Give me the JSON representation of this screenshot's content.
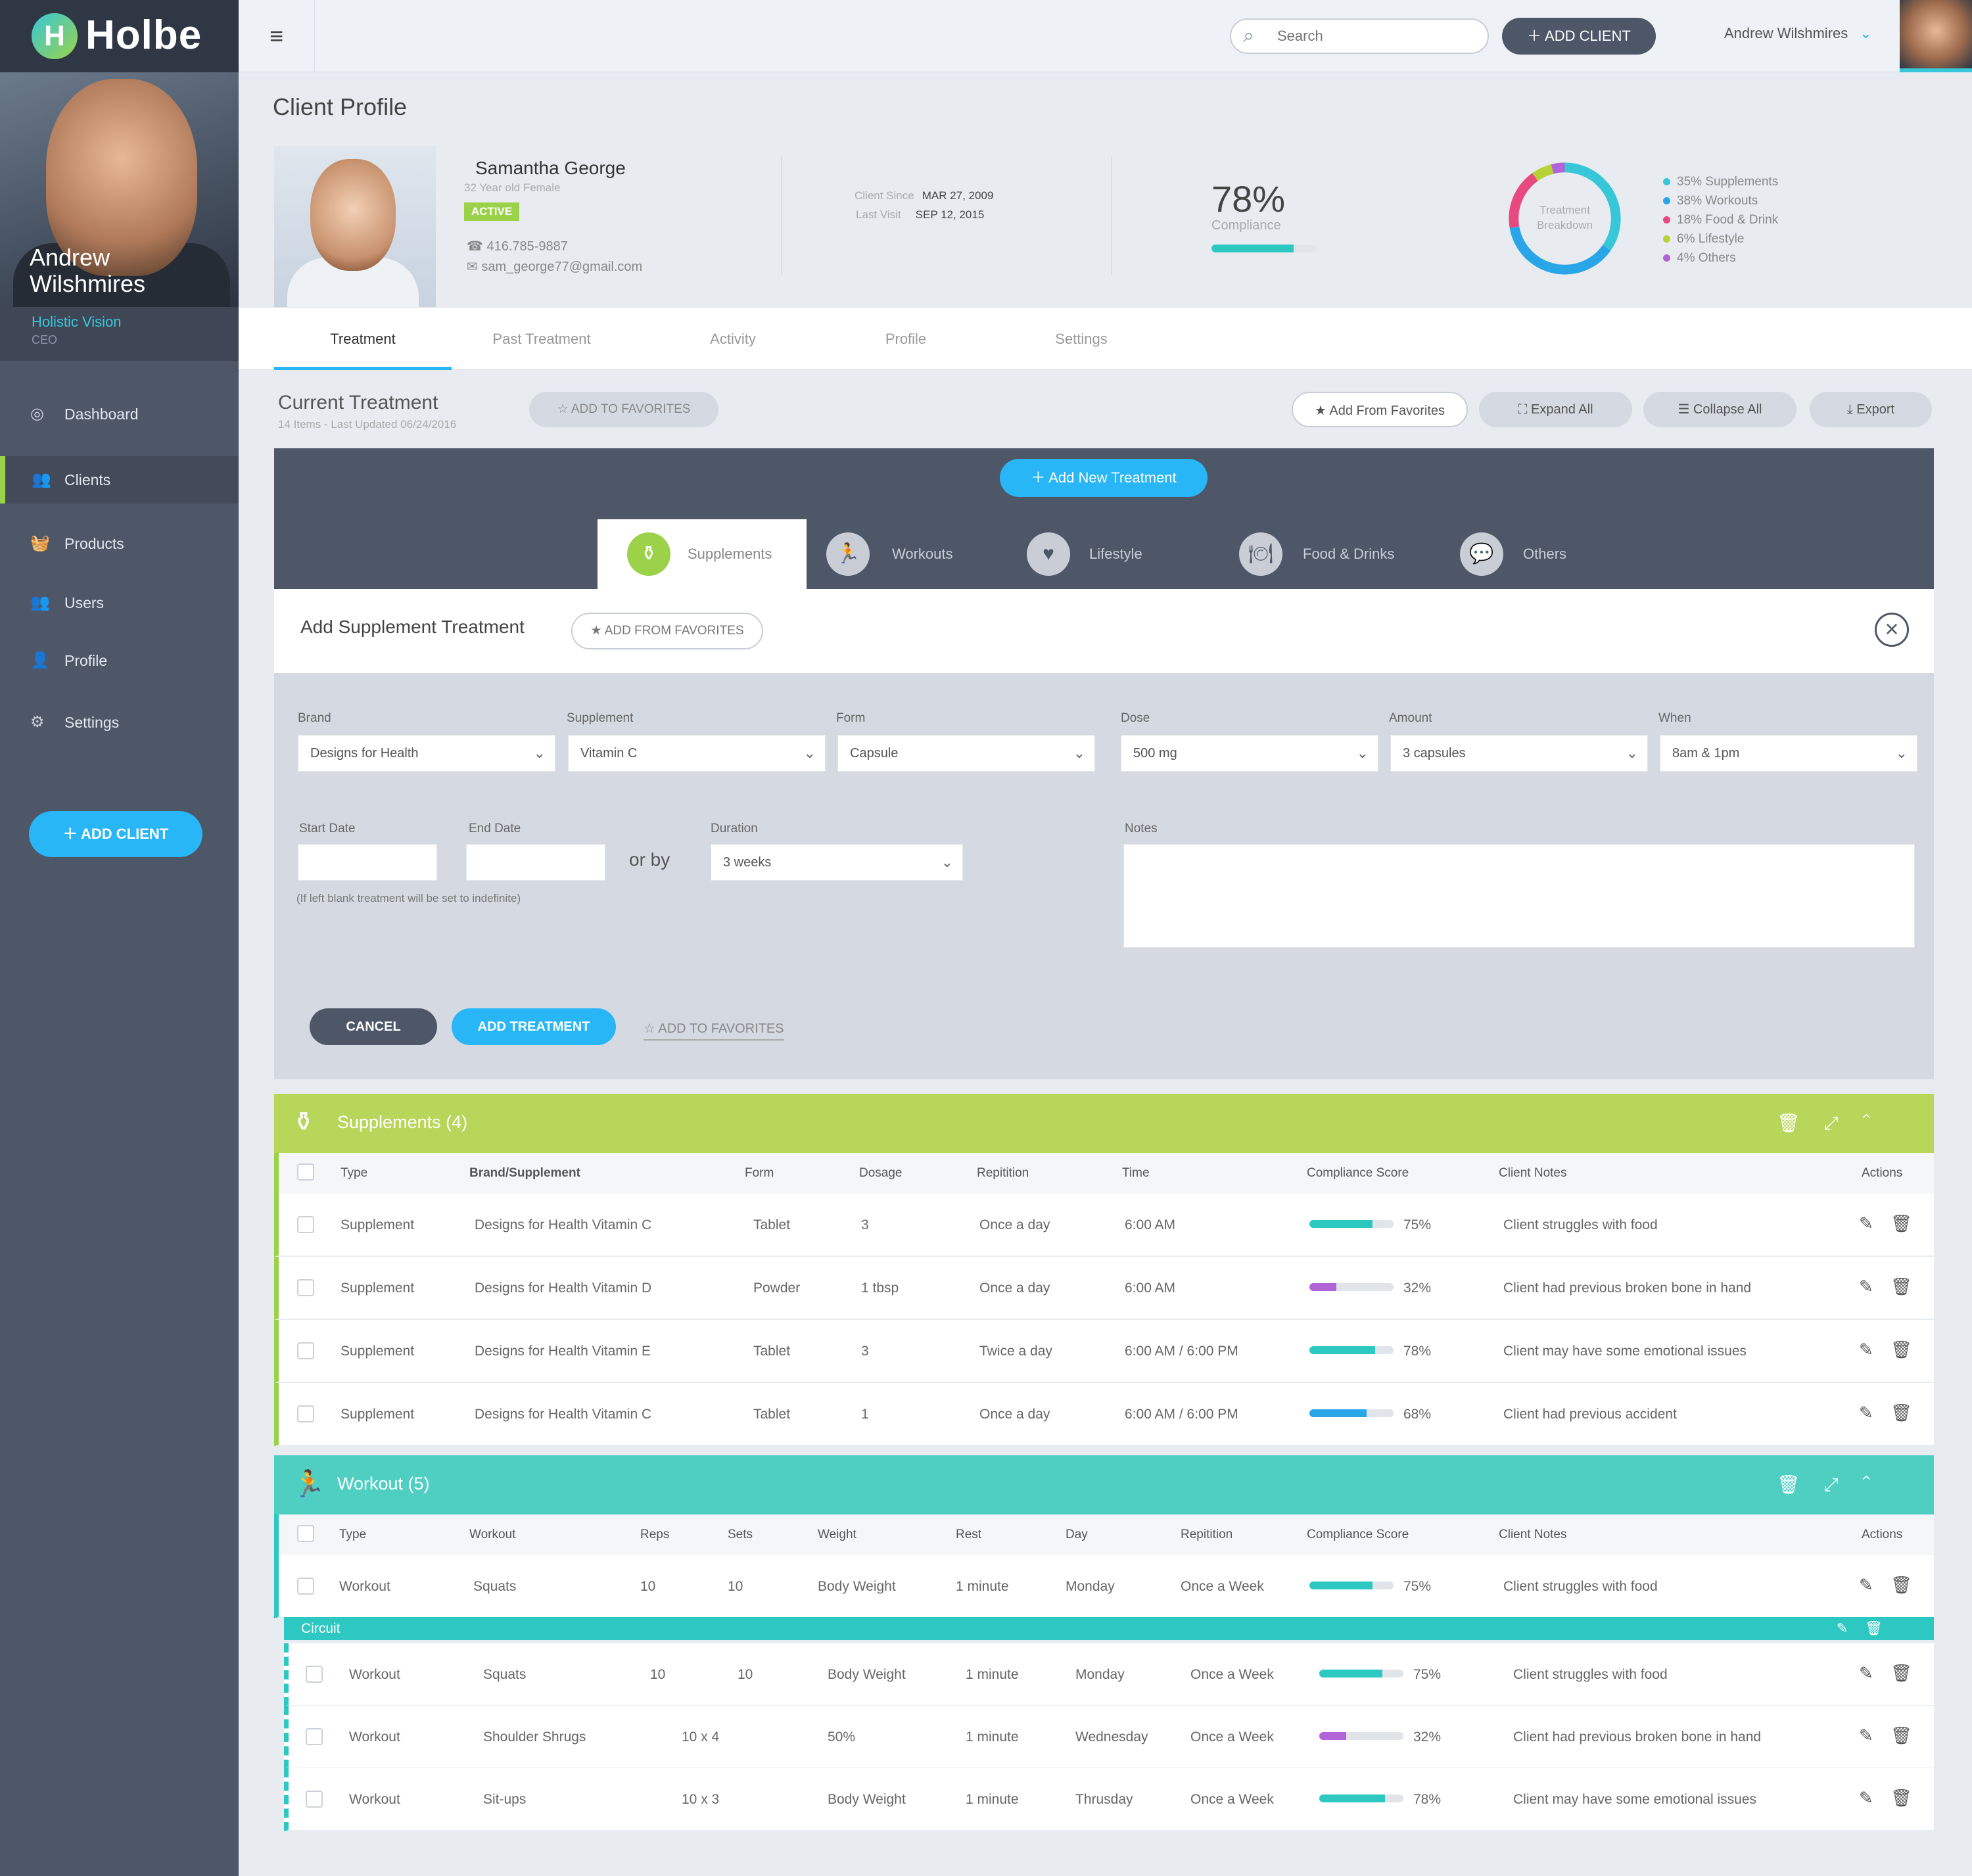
{
  "app": {
    "name": "Holbe",
    "logo_letter": "H"
  },
  "sidebar": {
    "user_first": "Andrew",
    "user_last": "Wilshmires",
    "org": "Holistic Vision",
    "role": "CEO",
    "items": [
      {
        "label": "Dashboard",
        "icon": "dashboard-icon"
      },
      {
        "label": "Clients",
        "icon": "clients-icon"
      },
      {
        "label": "Products",
        "icon": "basket-icon"
      },
      {
        "label": "Users",
        "icon": "users-icon"
      },
      {
        "label": "Profile",
        "icon": "profile-icon"
      },
      {
        "label": "Settings",
        "icon": "gear-icon"
      }
    ],
    "add_client": "ADD CLIENT"
  },
  "topbar": {
    "search_placeholder": "Search",
    "add_client": "ADD CLIENT",
    "user_name": "Andrew Wilshmires"
  },
  "profile": {
    "page_title": "Client Profile",
    "name": "Samantha George",
    "age": "32 Year old Female",
    "status": "ACTIVE",
    "phone": "416.785-9887",
    "email": "sam_george77@gmail.com",
    "client_since_label": "Client Since",
    "client_since": "MAR 27, 2009",
    "last_visit_label": "Last Visit",
    "last_visit": "SEP 12, 2015",
    "compliance": "78%",
    "compliance_label": "Compliance",
    "compliance_value": 0.78,
    "breakdown_label_1": "Treatment",
    "breakdown_label_2": "Breakdown",
    "breakdown": [
      {
        "label": "35% Supplements",
        "percent": 35,
        "color": "#38c7d8"
      },
      {
        "label": "38% Workouts",
        "percent": 38,
        "color": "#29a6e8"
      },
      {
        "label": "18% Food & Drink",
        "percent": 18,
        "color": "#e84a7f"
      },
      {
        "label": "6% Lifestyle",
        "percent": 6,
        "color": "#b5d334"
      },
      {
        "label": "4% Others",
        "percent": 4,
        "color": "#b164d8"
      }
    ]
  },
  "tabs": [
    "Treatment",
    "Past Treatment",
    "Activity",
    "Profile",
    "Settings"
  ],
  "current": {
    "title": "Current Treatment",
    "subtitle": "14 Items  -  Last Updated 06/24/2016",
    "add_to_favorites": "ADD TO FAVORITES",
    "add_from_favorites": "Add From Favorites",
    "expand_all": "Expand All",
    "collapse_all": "Collapse All",
    "export": "Export"
  },
  "builder": {
    "add_new": "Add New Treatment",
    "types": [
      "Supplements",
      "Workouts",
      "Lifestyle",
      "Food & Drinks",
      "Others"
    ],
    "form_title": "Add Supplement Treatment",
    "add_from_favorites": "ADD FROM FAVORITES",
    "fields": {
      "brand_label": "Brand",
      "brand": "Designs for Health",
      "supplement_label": "Supplement",
      "supplement": "Vitamin C",
      "form_label": "Form",
      "form": "Capsule",
      "dose_label": "Dose",
      "dose": "500 mg",
      "amount_label": "Amount",
      "amount": "3 capsules",
      "when_label": "When",
      "when": "8am & 1pm",
      "start_label": "Start Date",
      "end_label": "End Date",
      "or_by": "or by",
      "duration_label": "Duration",
      "duration": "3 weeks",
      "notes_label": "Notes",
      "hint": "(If left blank treatment will be set to indefinite)"
    },
    "cancel": "CANCEL",
    "add_treatment": "ADD TREATMENT",
    "add_to_favorites": "ADD TO FAVORITES"
  },
  "supplements": {
    "title": "Supplements   (4)",
    "headers": [
      "Type",
      "Brand/Supplement",
      "Form",
      "Dosage",
      "Repitition",
      "Time",
      "Compliance Score",
      "Client Notes",
      "Actions"
    ],
    "rows": [
      {
        "type": "Supplement",
        "brand": "Designs for Health Vitamin C",
        "form": "Tablet",
        "dosage": "3",
        "rep": "Once a day",
        "time": "6:00 AM",
        "score": "75%",
        "score_value": 0.75,
        "color": "#2ec8c2",
        "notes": "Client struggles with food"
      },
      {
        "type": "Supplement",
        "brand": "Designs for Health Vitamin D",
        "form": "Powder",
        "dosage": "1 tbsp",
        "rep": "Once a day",
        "time": "6:00 AM",
        "score": "32%",
        "score_value": 0.32,
        "color": "#b164d8",
        "notes": "Client had previous broken bone in hand"
      },
      {
        "type": "Supplement",
        "brand": "Designs for Health Vitamin E",
        "form": "Tablet",
        "dosage": "3",
        "rep": "Twice a day",
        "time": "6:00 AM / 6:00 PM",
        "score": "78%",
        "score_value": 0.78,
        "color": "#2ec8c2",
        "notes": "Client may have some emotional issues"
      },
      {
        "type": "Supplement",
        "brand": "Designs for Health Vitamin C",
        "form": "Tablet",
        "dosage": "1",
        "rep": "Once a day",
        "time": "6:00 AM / 6:00 PM",
        "score": "68%",
        "score_value": 0.68,
        "color": "#29a6e8",
        "notes": "Client had previous accident"
      }
    ]
  },
  "workout": {
    "title": "Workout  (5)",
    "headers": [
      "Type",
      "Workout",
      "Reps",
      "Sets",
      "Weight",
      "Rest",
      "Day",
      "Repitition",
      "Compliance Score",
      "Client Notes",
      "Actions"
    ],
    "circuit_label": "Circuit",
    "rows": [
      {
        "type": "Workout",
        "workout": "Squats",
        "reps": "10",
        "sets": "10",
        "weight": "Body Weight",
        "rest": "1 minute",
        "day": "Monday",
        "rep": "Once a Week",
        "score": "75%",
        "score_value": 0.75,
        "color": "#2ec8c2",
        "notes": "Client struggles with food"
      },
      {
        "type": "Workout",
        "workout": "Squats",
        "reps": "10",
        "sets": "10",
        "weight": "Body Weight",
        "rest": "1 minute",
        "day": "Monday",
        "rep": "Once a Week",
        "score": "75%",
        "score_value": 0.75,
        "color": "#2ec8c2",
        "notes": "Client struggles with food"
      },
      {
        "type": "Workout",
        "workout": "Shoulder Shrugs",
        "reps": "10 x 4",
        "sets": "",
        "weight": "50%",
        "rest": "1 minute",
        "day": "Wednesday",
        "rep": "Once a Week",
        "score": "32%",
        "score_value": 0.32,
        "color": "#b164d8",
        "notes": "Client had previous broken bone in hand"
      },
      {
        "type": "Workout",
        "workout": "Sit-ups",
        "reps": "10 x 3",
        "sets": "",
        "weight": "Body Weight",
        "rest": "1 minute",
        "day": "Thrusday",
        "rep": "Once a Week",
        "score": "78%",
        "score_value": 0.78,
        "color": "#2ec8c2",
        "notes": "Client may have some emotional issues"
      }
    ]
  },
  "colors": {
    "accent": "#29b6f6",
    "green": "#9bd24a",
    "teal": "#2ec8c2",
    "dark": "#4d5768"
  }
}
